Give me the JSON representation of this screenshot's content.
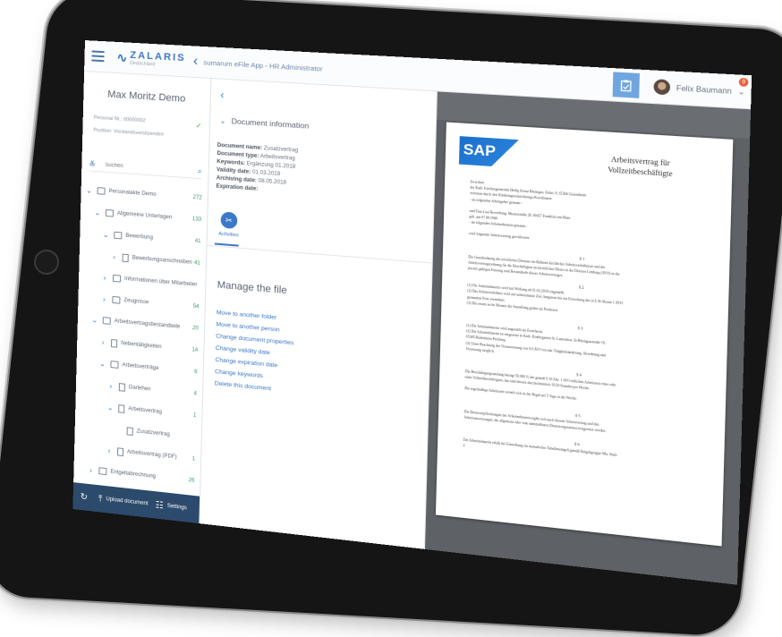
{
  "header": {
    "logo_name": "ZALARIS",
    "logo_sub": "Deutschland",
    "app_title": "sumarum eFile App - HR Administrator",
    "user_name": "Felix Baumann",
    "badge_count": "9"
  },
  "left_panel": {
    "person_name": "Max Moritz Demo",
    "personnel_no_label": "Personal Nr.: 00000002",
    "position_label": "Position: Vorstandsvorsitzende/r",
    "search_placeholder": "Suchen",
    "tree": [
      {
        "label": "Personalakte Demo",
        "count": "272",
        "indent": 0,
        "type": "folder",
        "chev": "v"
      },
      {
        "label": "Allgemeine Unterlagen",
        "count": "133",
        "indent": 1,
        "type": "folder",
        "chev": "v"
      },
      {
        "label": "Bewerbung",
        "count": "41",
        "indent": 2,
        "type": "folder",
        "chev": "v"
      },
      {
        "label": "Bewerbungsanschreiben",
        "count": "41",
        "indent": 3,
        "type": "doc",
        "chev": ">"
      },
      {
        "label": "Informationen über Mitarbeiter",
        "count": "",
        "indent": 2,
        "type": "folder",
        "chev": ">"
      },
      {
        "label": "Zeugnisse",
        "count": "54",
        "indent": 2,
        "type": "folder",
        "chev": ">"
      },
      {
        "label": "Arbeitsvertragsbestandteile",
        "count": "20",
        "indent": 1,
        "type": "folder",
        "chev": "v"
      },
      {
        "label": "Nebentätigkeiten",
        "count": "14",
        "indent": 2,
        "type": "doc",
        "chev": ">"
      },
      {
        "label": "Arbeitsverträge",
        "count": "6",
        "indent": 2,
        "type": "folder",
        "chev": "v"
      },
      {
        "label": "Darlehen",
        "count": "4",
        "indent": 3,
        "type": "doc",
        "chev": ">"
      },
      {
        "label": "Arbeitsvertrag",
        "count": "1",
        "indent": 3,
        "type": "doc",
        "chev": "v"
      },
      {
        "label": "Zusatzvertrag",
        "count": "",
        "indent": 4,
        "type": "doc",
        "chev": ""
      },
      {
        "label": "Arbeitsvertrag (PDF)",
        "count": "1",
        "indent": 3,
        "type": "doc",
        "chev": ">"
      },
      {
        "label": "Entgeltabrechnung",
        "count": "26",
        "indent": 1,
        "type": "folder",
        "chev": ">"
      }
    ],
    "footer": {
      "upload_label": "Upload document",
      "settings_label": "Settings"
    }
  },
  "middle_panel": {
    "section_title": "Document information",
    "info": [
      {
        "label": "Document name:",
        "value": "Zusatzvertrag"
      },
      {
        "label": "Document type:",
        "value": "Arbeitsvertrag"
      },
      {
        "label": "Keywords:",
        "value": "Ergänzung 01.2018"
      },
      {
        "label": "Validity date:",
        "value": "01.03.2018"
      },
      {
        "label": "Archiving date:",
        "value": "08.05.2018"
      },
      {
        "label": "Expiration date:",
        "value": ""
      }
    ],
    "activities_label": "Activities",
    "manage_title": "Manage the file",
    "actions": [
      "Move to another folder",
      "Move to another person",
      "Change document properties",
      "Change validity date",
      "Change expiration date",
      "Change keywords",
      "Delete this document"
    ]
  },
  "document": {
    "logo_text": "SAP",
    "title_line1": "Arbeitsvertrag für",
    "title_line2": "Vollzeitbeschäftigte",
    "lines": [
      "Zwischen",
      "der Kath. Kirchengemeinde Heilig Kreuz Rheingau, Zehnt. 8, 65366 Geisenheim",
      "vertreten durch den Kindertageseinrichtungs-Koordinator",
      "- im folgenden Arbeitgeber genannt -",
      "und Frau Lisa Bewerbung, Musterstraße 28, 60437 Frankfurt am Main",
      "geb. am 07.08.1968",
      "- im folgenden Arbeitnehmerin genannt -",
      "wird folgender Arbeitsvertrag geschlossen:",
      "§ 1",
      "Die Grundordnung des kirchlichen Dienstes im Rahmen kirchlicher Arbeitsverhältnisse und die",
      "Arbeitsvertragsordnung für die Beschäftigten im kirchlichen Dienst in der Diözese Limburg (AVO) in der",
      "jeweils gültigen Fassung sind Bestandteile dieses Arbeitsvertrages.",
      "§ 2",
      "(1) Die Arbeitnehmerin wird mit Wirkung ab 01.02.2018 eingestellt.",
      "(2) Das Arbeitsverhältnis wird auf unbestimmte Zeit, längstens bis zur Erreichung der in § 36 Absatz 1 AVO",
      "genannten Frist vereinbart.",
      "(3) Die ersten sechs Monate der Anstellung gelten als Probezeit.",
      "§ 3",
      "(1) Die Arbeitnehmerin wird angestellt als Erzieherin.",
      "(2) Die Arbeitnehmerin ist eingesetzt in Kath. Kindergarten St. Laurentius, In Rheingaustraße 16,",
      "65385 Rüdesheim-Presberg.",
      "(3) Unter Beachtung der Voraussetzung von § 6 AVO ist eine Tätigkeitsänderung, Abordnung und",
      "Versetzung möglich.",
      "§ 4",
      "Die Beschäftigungsumfang beträgt 50.000 % der gemäß § 10 Abs. 1 AVO üblichen Arbeitszeit eines oder",
      "einer Vollzeitbeschäftigten, das sind derzeit durchschnittlich 19,50 Stunden pro Woche.",
      "Die regelmäßige Arbeitszeit verteilt sich in der Regel auf 5 Tage in der Woche.",
      "§ 5",
      "Die Dienstverpflichtungen der Arbeitnehmerin ergibt sich nach diesem Arbeitsvertrag und den",
      "Arbeitsanweisungen, die allgemein oder vom unmittelbaren Dienstvorgesetzten festgesetzt werden.",
      "§ 6",
      "Die Arbeitnehmerin erhält bei Einstellung ein monatliches Tabellenentgelt gemäß Entgeltgruppe S8a, Stufe",
      "2."
    ]
  }
}
